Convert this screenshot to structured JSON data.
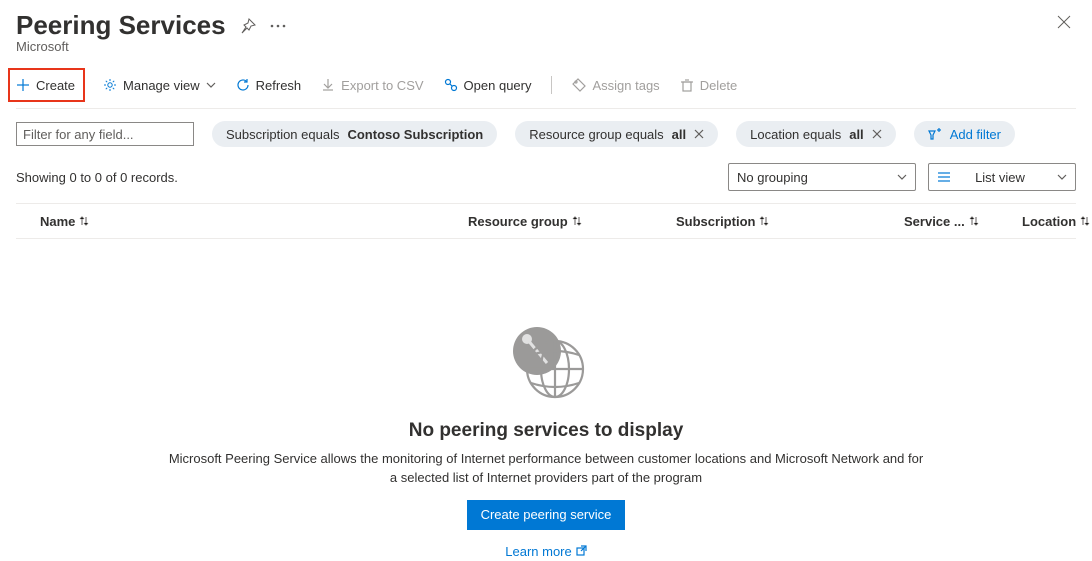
{
  "header": {
    "title": "Peering Services",
    "subtitle": "Microsoft"
  },
  "toolbar": {
    "create_label": "Create",
    "manage_view_label": "Manage view",
    "refresh_label": "Refresh",
    "export_csv_label": "Export to CSV",
    "open_query_label": "Open query",
    "assign_tags_label": "Assign tags",
    "delete_label": "Delete"
  },
  "filters": {
    "filter_placeholder": "Filter for any field...",
    "subscription": {
      "label_pre": "Subscription equals ",
      "value": "Contoso Subscription"
    },
    "resource_group": {
      "label_pre": "Resource group equals ",
      "value": "all"
    },
    "location": {
      "label_pre": "Location equals ",
      "value": "all"
    },
    "add_filter_label": "Add filter"
  },
  "records": {
    "showing_text": "Showing 0 to 0 of 0 records.",
    "grouping_label": "No grouping",
    "listview_label": "List view"
  },
  "columns": {
    "name": "Name",
    "resource_group": "Resource group",
    "subscription": "Subscription",
    "service": "Service ...",
    "location": "Location"
  },
  "empty": {
    "title": "No peering services to display",
    "desc": "Microsoft Peering Service allows the monitoring of Internet performance between customer locations and Microsoft Network and for a selected list of Internet providers part of the program",
    "create_btn": "Create peering service",
    "learn": "Learn more"
  }
}
